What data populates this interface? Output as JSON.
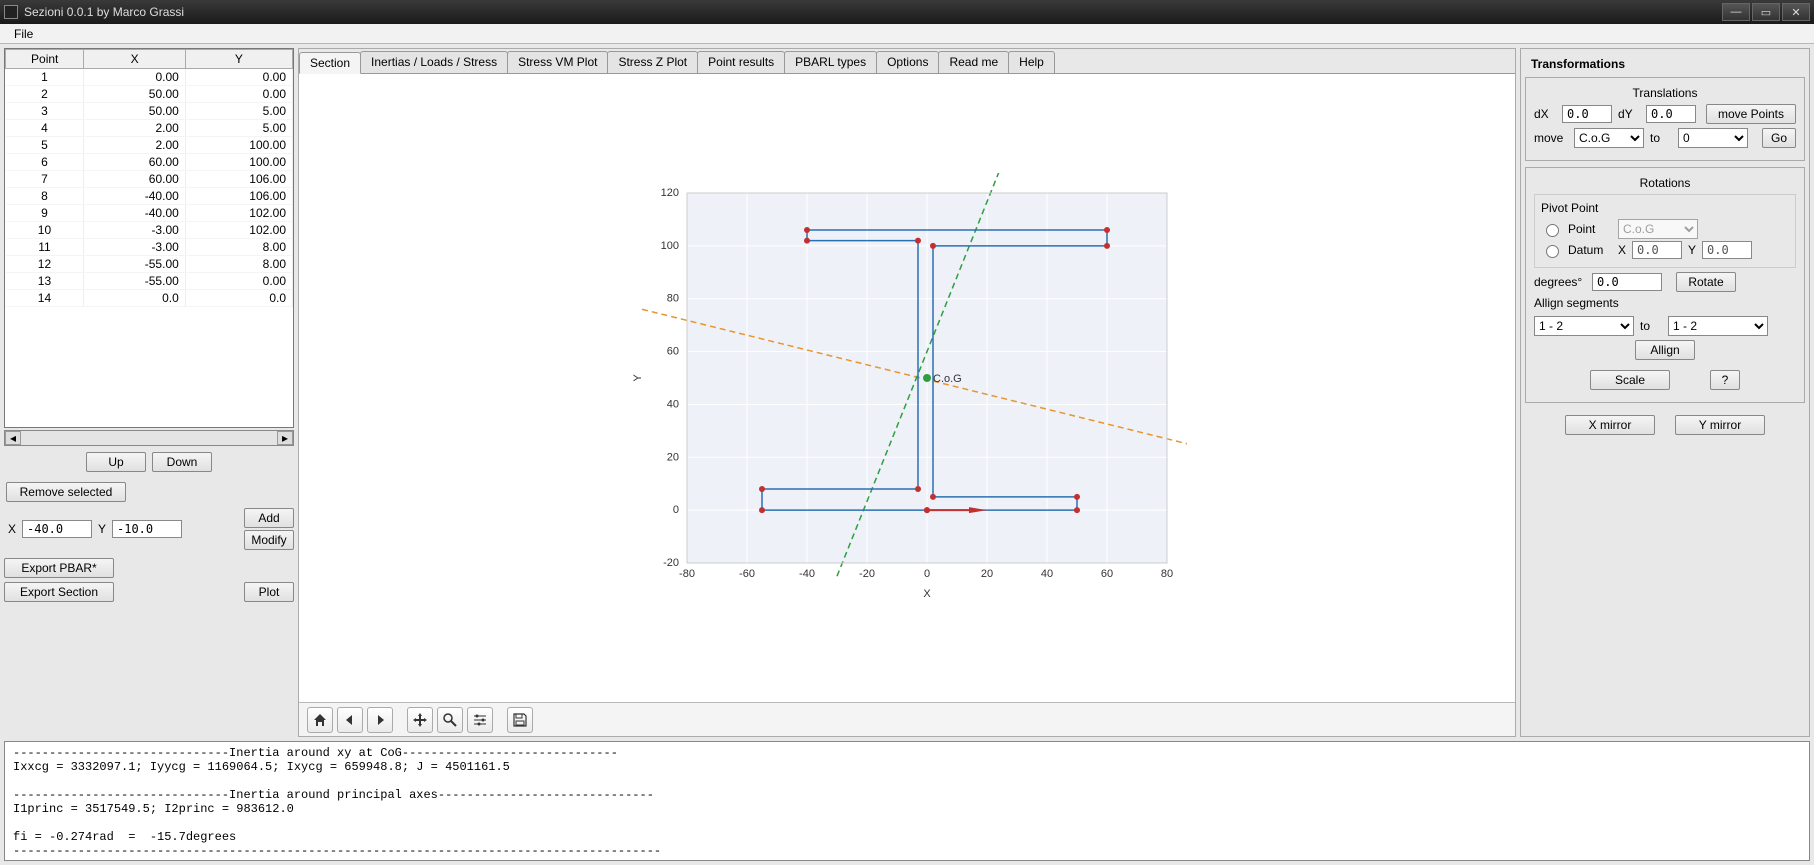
{
  "window": {
    "title": "Sezioni 0.0.1 by Marco Grassi",
    "menu": {
      "file": "File"
    }
  },
  "points_table": {
    "headers": [
      "Point",
      "X",
      "Y"
    ],
    "rows": [
      {
        "n": "1",
        "x": "0.00",
        "y": "0.00"
      },
      {
        "n": "2",
        "x": "50.00",
        "y": "0.00"
      },
      {
        "n": "3",
        "x": "50.00",
        "y": "5.00"
      },
      {
        "n": "4",
        "x": "2.00",
        "y": "5.00"
      },
      {
        "n": "5",
        "x": "2.00",
        "y": "100.00"
      },
      {
        "n": "6",
        "x": "60.00",
        "y": "100.00"
      },
      {
        "n": "7",
        "x": "60.00",
        "y": "106.00"
      },
      {
        "n": "8",
        "x": "-40.00",
        "y": "106.00"
      },
      {
        "n": "9",
        "x": "-40.00",
        "y": "102.00"
      },
      {
        "n": "10",
        "x": "-3.00",
        "y": "102.00"
      },
      {
        "n": "11",
        "x": "-3.00",
        "y": "8.00"
      },
      {
        "n": "12",
        "x": "-55.00",
        "y": "8.00"
      },
      {
        "n": "13",
        "x": "-55.00",
        "y": "0.00"
      },
      {
        "n": "14",
        "x": "0.0",
        "y": "0.0"
      }
    ]
  },
  "buttons": {
    "up": "Up",
    "down": "Down",
    "remove": "Remove selected",
    "add": "Add",
    "modify": "Modify",
    "export_pbar": "Export PBAR*",
    "export_section": "Export Section",
    "plot": "Plot"
  },
  "xy_inputs": {
    "x_label": "X",
    "x_val": "-40.0",
    "y_label": "Y",
    "y_val": "-10.0"
  },
  "tabs": [
    "Section",
    "Inertias / Loads / Stress",
    "Stress VM Plot",
    "Stress Z Plot",
    "Point results",
    "PBARL types",
    "Options",
    "Read me",
    "Help"
  ],
  "active_tab": 0,
  "transform": {
    "title": "Transformations",
    "translations_title": "Translations",
    "dX_label": "dX",
    "dX_val": "0.0",
    "dY_label": "dY",
    "dY_val": "0.0",
    "move_points": "move Points",
    "move_label": "move",
    "move_from": "C.o.G",
    "to_label": "to",
    "move_to": "0",
    "go": "Go",
    "rotations_title": "Rotations",
    "pivot_title": "Pivot Point",
    "pivot_point_label": "Point",
    "pivot_point_sel": "C.o.G",
    "pivot_datum_label": "Datum",
    "pivot_x_label": "X",
    "pivot_x": "0.0",
    "pivot_y_label": "Y",
    "pivot_y": "0.0",
    "degrees_label": "degrees°",
    "degrees_val": "0.0",
    "rotate": "Rotate",
    "align_title": "Allign segments",
    "align_from": "1 - 2",
    "align_to": "1 - 2",
    "align_btn": "Allign",
    "scale": "Scale",
    "help": "?",
    "x_mirror": "X mirror",
    "y_mirror": "Y mirror"
  },
  "log": "------------------------------Inertia around xy at CoG------------------------------\nIxxcg = 3332097.1; Iyycg = 1169064.5; Ixycg = 659948.8; J = 4501161.5\n\n------------------------------Inertia around principal axes------------------------------\nI1princ = 3517549.5; I2princ = 983612.0\n\nfi = -0.274rad  =  -15.7degrees\n------------------------------------------------------------------------------------------",
  "chart_data": {
    "type": "line",
    "title": "",
    "xlabel": "X",
    "ylabel": "Y",
    "xlim": [
      -80,
      80
    ],
    "ylim": [
      -20,
      120
    ],
    "xticks": [
      -80,
      -60,
      -40,
      -20,
      0,
      20,
      40,
      60,
      80
    ],
    "yticks": [
      -20,
      0,
      20,
      40,
      60,
      80,
      100,
      120
    ],
    "cog_label": "C.o.G",
    "cog": {
      "x": 0,
      "y": 50
    },
    "section_polygon": [
      [
        0,
        0
      ],
      [
        50,
        0
      ],
      [
        50,
        5
      ],
      [
        2,
        5
      ],
      [
        2,
        100
      ],
      [
        60,
        100
      ],
      [
        60,
        106
      ],
      [
        -40,
        106
      ],
      [
        -40,
        102
      ],
      [
        -3,
        102
      ],
      [
        -3,
        8
      ],
      [
        -55,
        8
      ],
      [
        -55,
        0
      ],
      [
        0,
        0
      ]
    ],
    "principal_axis_1": [
      [
        -95,
        76
      ],
      [
        105,
        20
      ]
    ],
    "principal_axis_2": [
      [
        -30,
        -25
      ],
      [
        30,
        145
      ]
    ]
  }
}
